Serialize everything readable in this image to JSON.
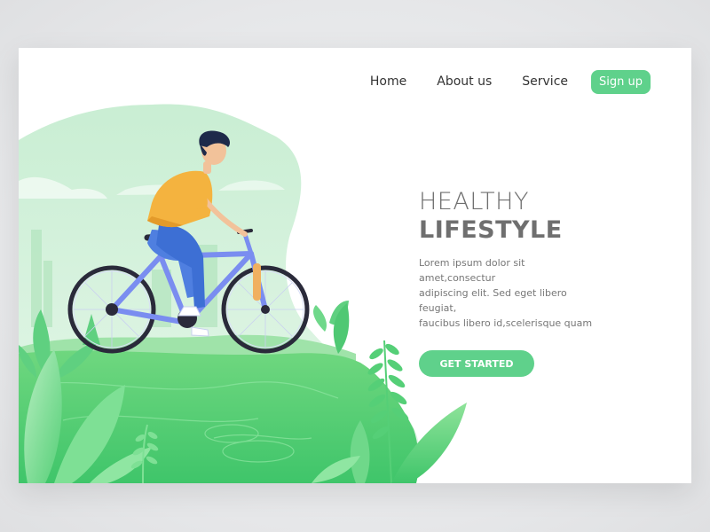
{
  "nav": {
    "items": [
      {
        "label": "Home"
      },
      {
        "label": "About us"
      },
      {
        "label": "Service"
      }
    ],
    "signup_label": "Sign up"
  },
  "hero": {
    "title_line1": "HEALTHY",
    "title_line2": "LIFESTYLE",
    "body_line1": "Lorem ipsum dolor sit amet,consectur",
    "body_line2": "adipiscing elit. Sed eget libero feugiat,",
    "body_line3": "faucibus libero id,scelerisque quam",
    "cta_label": "GET STARTED"
  },
  "colors": {
    "accent": "#5fd18b",
    "text_dark": "#333333",
    "title": "#6f6f6f",
    "body": "#777777",
    "shirt": "#f4b33f",
    "pants": "#4f7fe0",
    "bike": "#7a8df0",
    "grass_dark": "#4fcf6f",
    "grass_light": "#a8e6b4"
  }
}
